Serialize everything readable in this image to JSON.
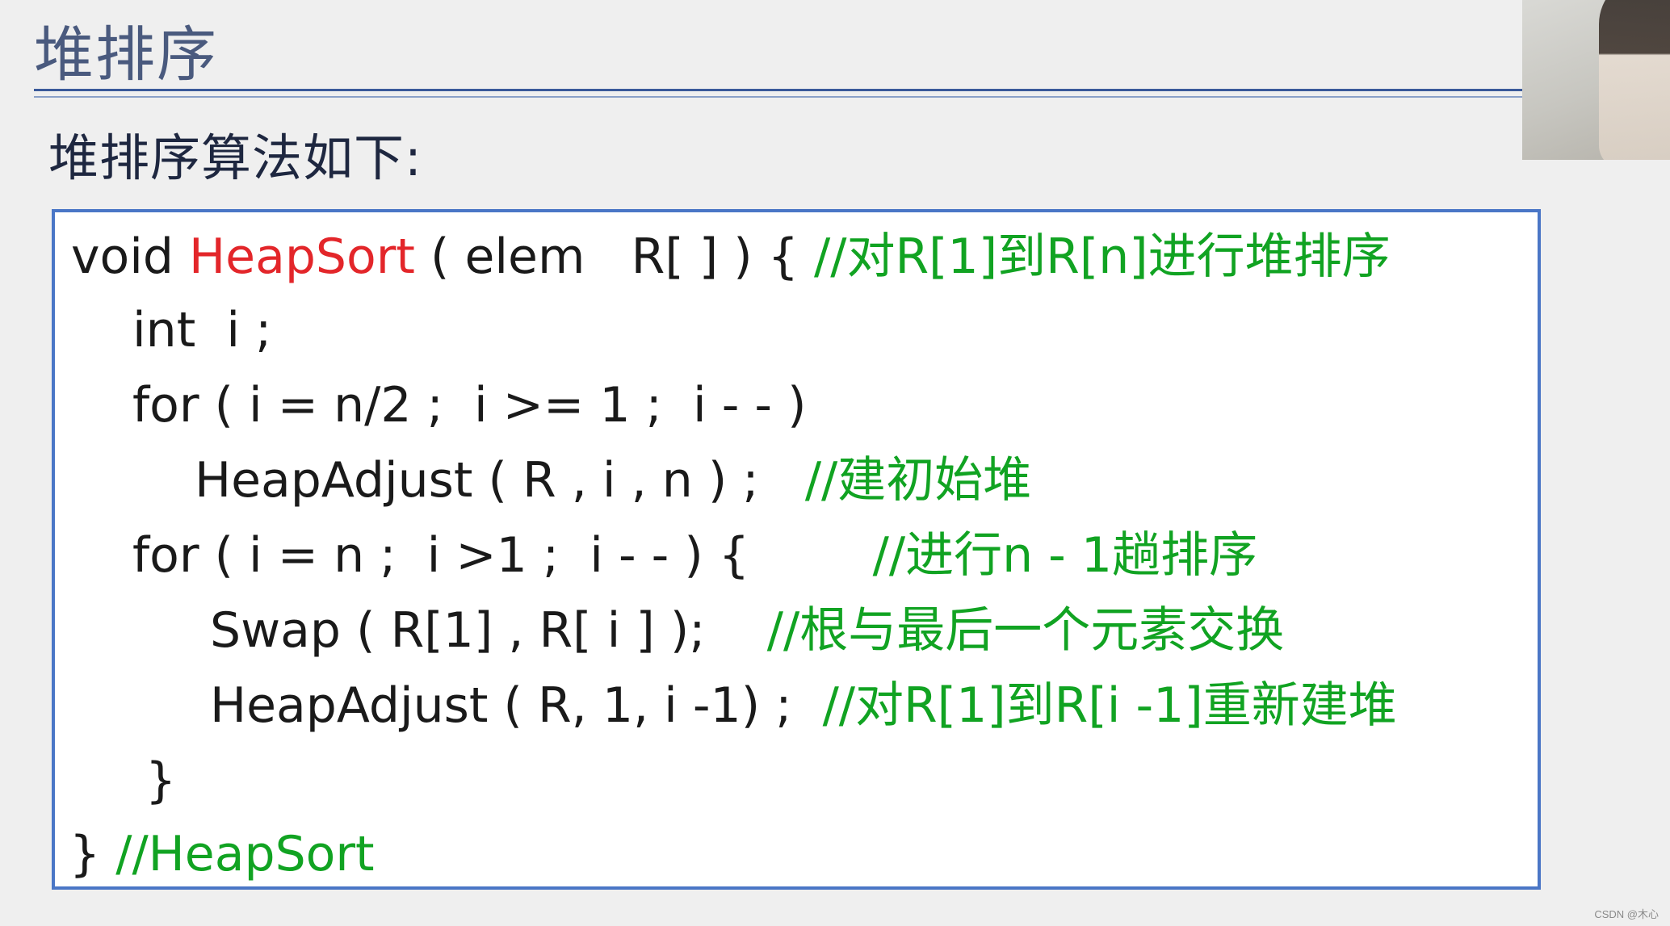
{
  "slide": {
    "title": "堆排序",
    "subtitle": "堆排序算法如下:"
  },
  "code": {
    "line1": {
      "prefix": "void ",
      "fn_name": "HeapSort",
      "rest": " ( elem   R[ ] ) { ",
      "comment": "//对R[1]到R[n]进行堆排序"
    },
    "line2": {
      "text": "int  i ;"
    },
    "line3": {
      "text": "for ( i = n/2 ;  i >= 1 ;  i - - )"
    },
    "line4": {
      "code": "HeapAdjust ( R , i , n ) ;   ",
      "comment": "//建初始堆"
    },
    "line5": {
      "code": "for ( i = n ;  i >1 ;  i - - ) {        ",
      "comment": "//进行n - 1趟排序"
    },
    "line6": {
      "code": "Swap ( R[1] , R[ i ] );    ",
      "comment": "//根与最后一个元素交换"
    },
    "line7": {
      "code": "HeapAdjust ( R, 1, i -1) ;  ",
      "comment": "//对R[1]到R[i -1]重新建堆"
    },
    "line8": {
      "text": "}"
    },
    "line9": {
      "code": "} ",
      "comment": "//HeapSort"
    }
  },
  "colors": {
    "function_name": "#e3262a",
    "comment": "#11a322",
    "border": "#4a76c6",
    "title": "#4a5a7e"
  },
  "watermark": "CSDN @木心"
}
